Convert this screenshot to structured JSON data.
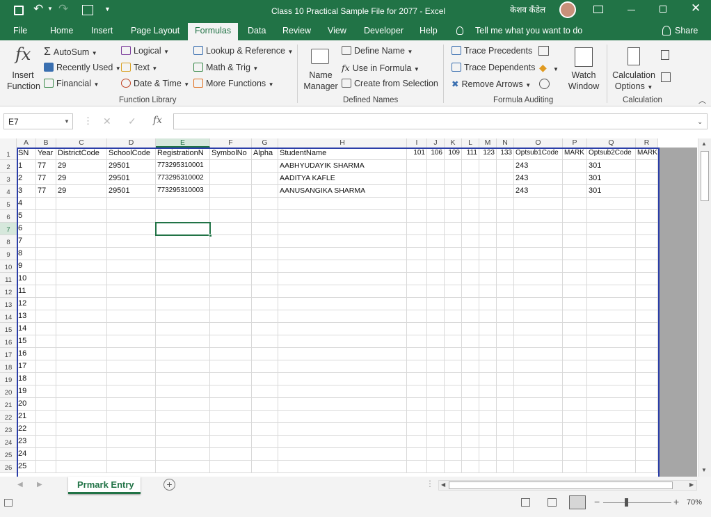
{
  "app": {
    "title": "Class 10 Practical Sample File for 2077  -  Excel",
    "user": "केशव कँडेल"
  },
  "ribbon_tabs": [
    "File",
    "Home",
    "Insert",
    "Page Layout",
    "Formulas",
    "Data",
    "Review",
    "View",
    "Developer",
    "Help"
  ],
  "active_tab": "Formulas",
  "tell_me": "Tell me what you want to do",
  "share": "Share",
  "ribbon": {
    "insert_function": [
      "Insert",
      "Function"
    ],
    "autosum": "AutoSum",
    "recently_used": "Recently Used",
    "financial": "Financial",
    "logical": "Logical",
    "text": "Text",
    "date_time": "Date & Time",
    "lookup": "Lookup & Reference",
    "math_trig": "Math & Trig",
    "more_functions": "More Functions",
    "name_manager": [
      "Name",
      "Manager"
    ],
    "define_name": "Define Name",
    "use_in_formula": "Use in Formula",
    "create_from_selection": "Create from Selection",
    "trace_precedents": "Trace Precedents",
    "trace_dependents": "Trace Dependents",
    "remove_arrows": "Remove Arrows",
    "watch_window": [
      "Watch",
      "Window"
    ],
    "calc_options": [
      "Calculation",
      "Options"
    ],
    "groups": {
      "function_library": "Function Library",
      "defined_names": "Defined Names",
      "formula_auditing": "Formula Auditing",
      "calculation": "Calculation"
    }
  },
  "name_box": "E7",
  "formula_value": "",
  "columns": [
    "A",
    "B",
    "C",
    "D",
    "E",
    "F",
    "G",
    "H",
    "I",
    "J",
    "K",
    "L",
    "M",
    "N",
    "O",
    "P",
    "Q",
    "R"
  ],
  "header_row": [
    "SN",
    "Year",
    "DistrictCode",
    "SchoolCode",
    "RegistrationN",
    "SymbolNo",
    "Alpha",
    "StudentName",
    "101",
    "106",
    "109",
    "111",
    "123",
    "133",
    "Optsub1Code",
    "MARK",
    "Optsub2Code",
    "MARK"
  ],
  "data_rows": [
    [
      "1",
      "77",
      "29",
      "29501",
      "773295310001",
      "",
      "",
      "AABHYUDAYIK  SHARMA",
      "",
      "",
      "",
      "",
      "",
      "",
      "243",
      "",
      "301",
      ""
    ],
    [
      "2",
      "77",
      "29",
      "29501",
      "773295310002",
      "",
      "",
      "AADITYA  KAFLE",
      "",
      "",
      "",
      "",
      "",
      "",
      "243",
      "",
      "301",
      ""
    ],
    [
      "3",
      "77",
      "29",
      "29501",
      "773295310003",
      "",
      "",
      "AANUSANGIKA  SHARMA",
      "",
      "",
      "",
      "",
      "",
      "",
      "243",
      "",
      "301",
      ""
    ]
  ],
  "sn_continued": [
    "4",
    "5",
    "6",
    "7",
    "8",
    "9",
    "10",
    "11",
    "12",
    "13",
    "14",
    "15",
    "16",
    "17",
    "18",
    "19",
    "20",
    "21",
    "22",
    "23",
    "24",
    "25"
  ],
  "row_numbers": [
    "1",
    "2",
    "3",
    "4",
    "5",
    "6",
    "7",
    "8",
    "9",
    "10",
    "11",
    "12",
    "13",
    "14",
    "15",
    "16",
    "17",
    "18",
    "19",
    "20",
    "21",
    "22",
    "23",
    "24",
    "25",
    "26"
  ],
  "sheet_tab": "Prmark Entry",
  "zoom": "70%",
  "colors": {
    "accent": "#217346",
    "selection": "#217346",
    "print_border": "#2b3ea8"
  }
}
